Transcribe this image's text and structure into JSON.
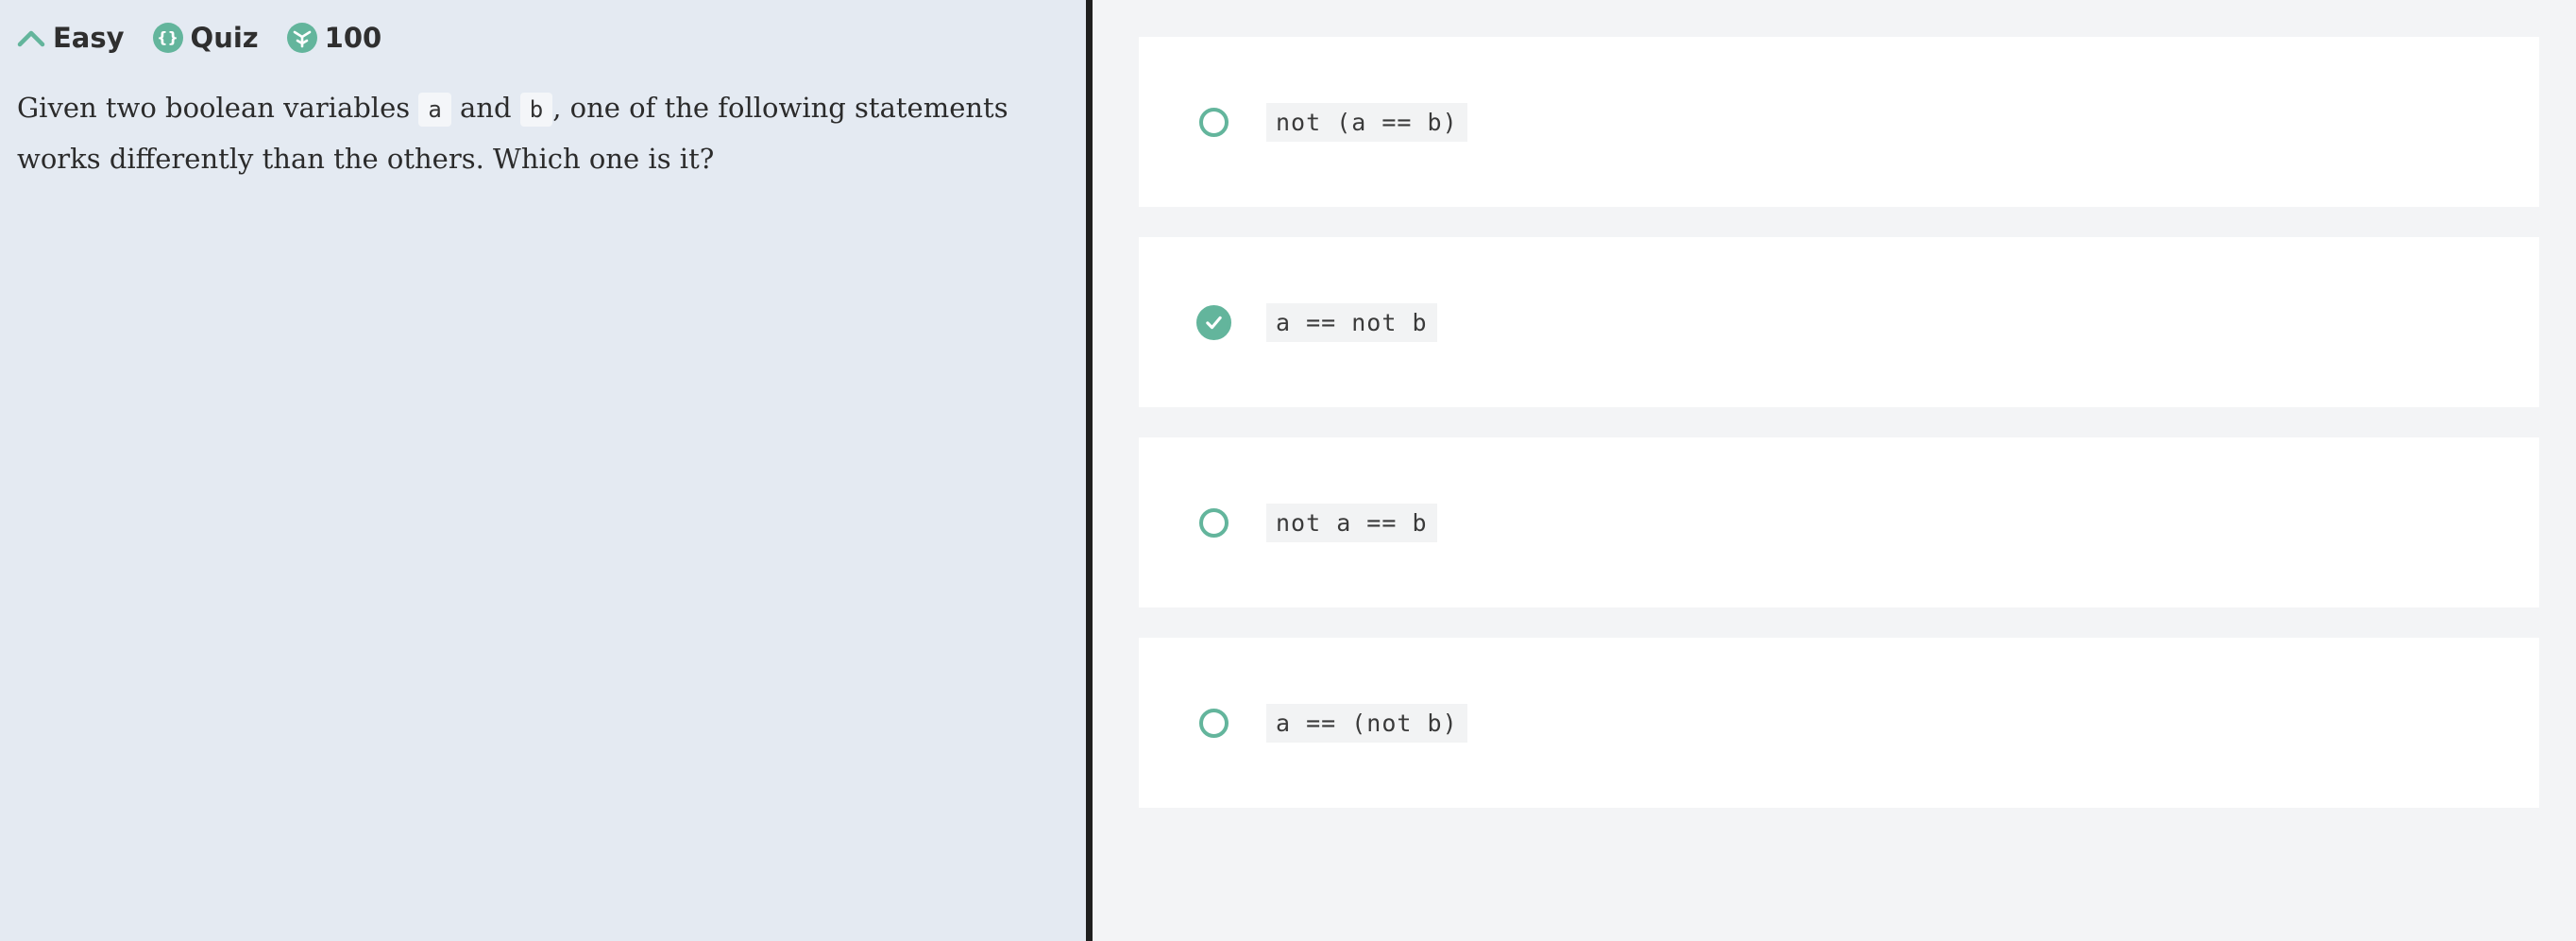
{
  "meta": {
    "difficulty": "Easy",
    "type": "Quiz",
    "points": "100"
  },
  "question": {
    "part1": "Given two boolean variables ",
    "var_a": "a",
    "part2": " and ",
    "var_b": "b",
    "part3": ", one of the following statements works differently than the others. Which one is it?"
  },
  "options": [
    {
      "code": "not (a == b)",
      "selected": false
    },
    {
      "code": "a == not b",
      "selected": true
    },
    {
      "code": "not a == b",
      "selected": false
    },
    {
      "code": "a == (not b)",
      "selected": false
    }
  ],
  "colors": {
    "accent": "#63b59c",
    "left_bg": "#e4eaf2",
    "right_bg": "#f3f4f6",
    "divider": "#1f1f1f"
  }
}
